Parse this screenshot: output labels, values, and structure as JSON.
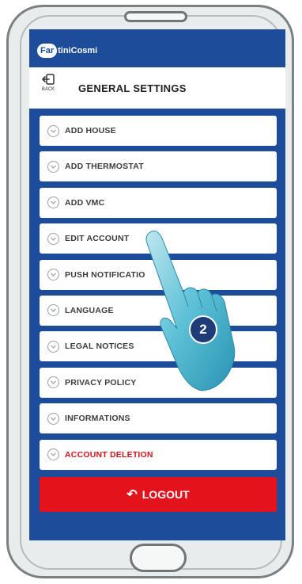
{
  "app": {
    "brand_badge": "Far",
    "brand_rest": "tiniCosmi"
  },
  "header": {
    "back_label": "BACK",
    "title": "GENERAL SETTINGS"
  },
  "menu": {
    "items": [
      {
        "label": "ADD HOUSE"
      },
      {
        "label": "ADD THERMOSTAT"
      },
      {
        "label": "ADD VMC"
      },
      {
        "label": "EDIT ACCOUNT"
      },
      {
        "label": "PUSH NOTIFICATIO"
      },
      {
        "label": "LANGUAGE"
      },
      {
        "label": "LEGAL NOTICES"
      },
      {
        "label": "PRIVACY POLICY"
      },
      {
        "label": "INFORMATIONS"
      },
      {
        "label": "ACCOUNT DELETION"
      }
    ]
  },
  "logout": {
    "icon": "reply-arrow-icon",
    "label": "LOGOUT"
  },
  "annotation": {
    "step": "2",
    "icon": "pointing-hand-icon"
  },
  "colors": {
    "brand_blue": "#1c4c9a",
    "danger_red": "#e3121b",
    "step_badge": "#1f3c78",
    "hand": "#38a9c6"
  }
}
